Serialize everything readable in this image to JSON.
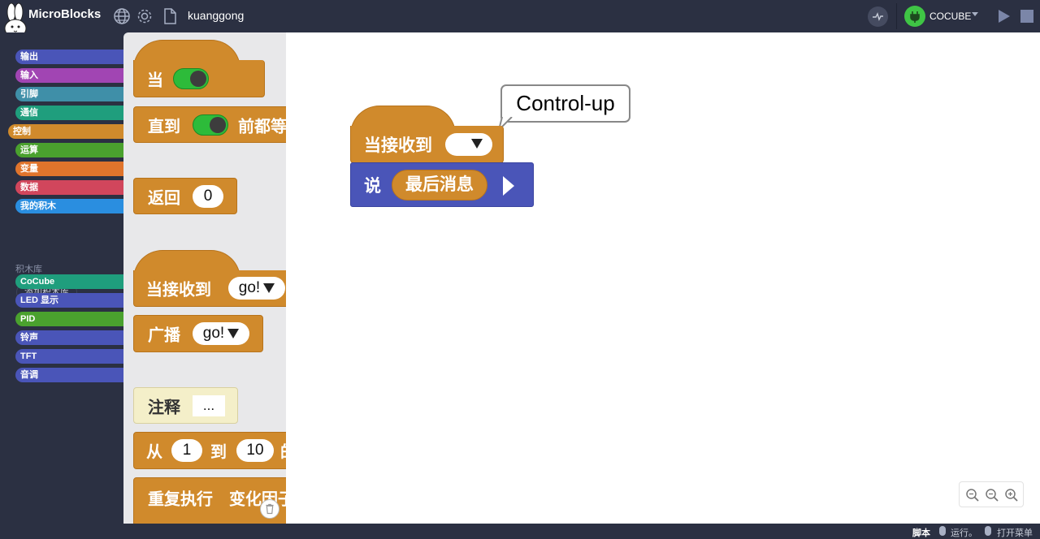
{
  "app": {
    "title": "MicroBlocks",
    "project_name": "kuanggong"
  },
  "board": {
    "name": "COCUBE",
    "status_color": "#3fc545"
  },
  "categories": [
    {
      "label": "输出",
      "color": "#4a55b8"
    },
    {
      "label": "输入",
      "color": "#a145b3"
    },
    {
      "label": "引脚",
      "color": "#3f8fa8"
    },
    {
      "label": "通信",
      "color": "#1f9e7d"
    },
    {
      "label": "控制",
      "color": "#d08a2c"
    },
    {
      "label": "运算",
      "color": "#4aa12e"
    },
    {
      "label": "变量",
      "color": "#e0742c"
    },
    {
      "label": "数据",
      "color": "#d1465c"
    },
    {
      "label": "我的积木",
      "color": "#2a8ee0"
    }
  ],
  "libraries": {
    "heading": "积木库",
    "add_button": "添加积木库",
    "items": [
      {
        "label": "CoCube",
        "color": "#1f9e7d"
      },
      {
        "label": "LED 显示",
        "color": "#4a55b8"
      },
      {
        "label": "PID",
        "color": "#4aa12e"
      },
      {
        "label": "铃声",
        "color": "#4a55b8"
      },
      {
        "label": "TFT",
        "color": "#4a55b8"
      },
      {
        "label": "音调",
        "color": "#4a55b8"
      }
    ]
  },
  "palette": {
    "when": "当",
    "wait_until": "直到",
    "wait_until_suffix": "前都等",
    "return_label": "返回",
    "return_value": "0",
    "when_received": "当接收到",
    "received_msg": "go!",
    "broadcast": "广播",
    "broadcast_msg": "go!",
    "comment": "注释",
    "comment_value": "...",
    "for_from": "从",
    "for_start": "1",
    "for_to": "到",
    "for_end": "10",
    "for_suffix": "的",
    "repeat": "重复执行",
    "repeat_suffix": "变化因子"
  },
  "canvas": {
    "bubble_text": "Control-up",
    "hat_label": "当接收到",
    "say_label": "说",
    "say_value": "最后消息"
  },
  "status": {
    "scripts": "脚本",
    "run": "运行。",
    "open_menu": "打开菜单"
  }
}
